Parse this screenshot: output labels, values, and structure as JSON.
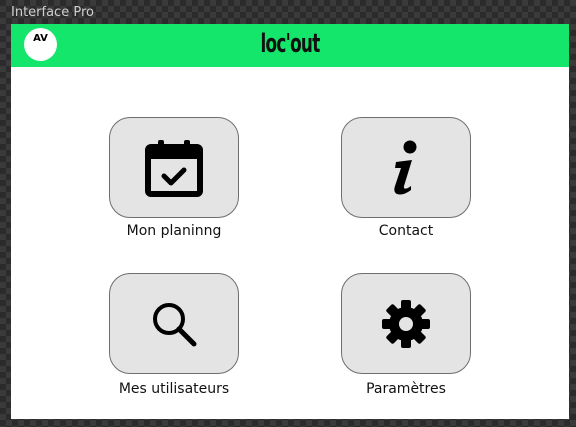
{
  "window": {
    "title": "Interface Pro"
  },
  "header": {
    "avatar_initials": "AV",
    "logo_text": "loc'out",
    "background_color": "#14e66c"
  },
  "menu": {
    "items": [
      {
        "label": "Mon planinng",
        "icon": "calendar-check-icon"
      },
      {
        "label": "Contact",
        "icon": "info-icon"
      },
      {
        "label": "Mes utilisateurs",
        "icon": "search-icon"
      },
      {
        "label": "Paramètres",
        "icon": "gear-icon"
      }
    ],
    "tile_color": "#e4e4e4"
  }
}
